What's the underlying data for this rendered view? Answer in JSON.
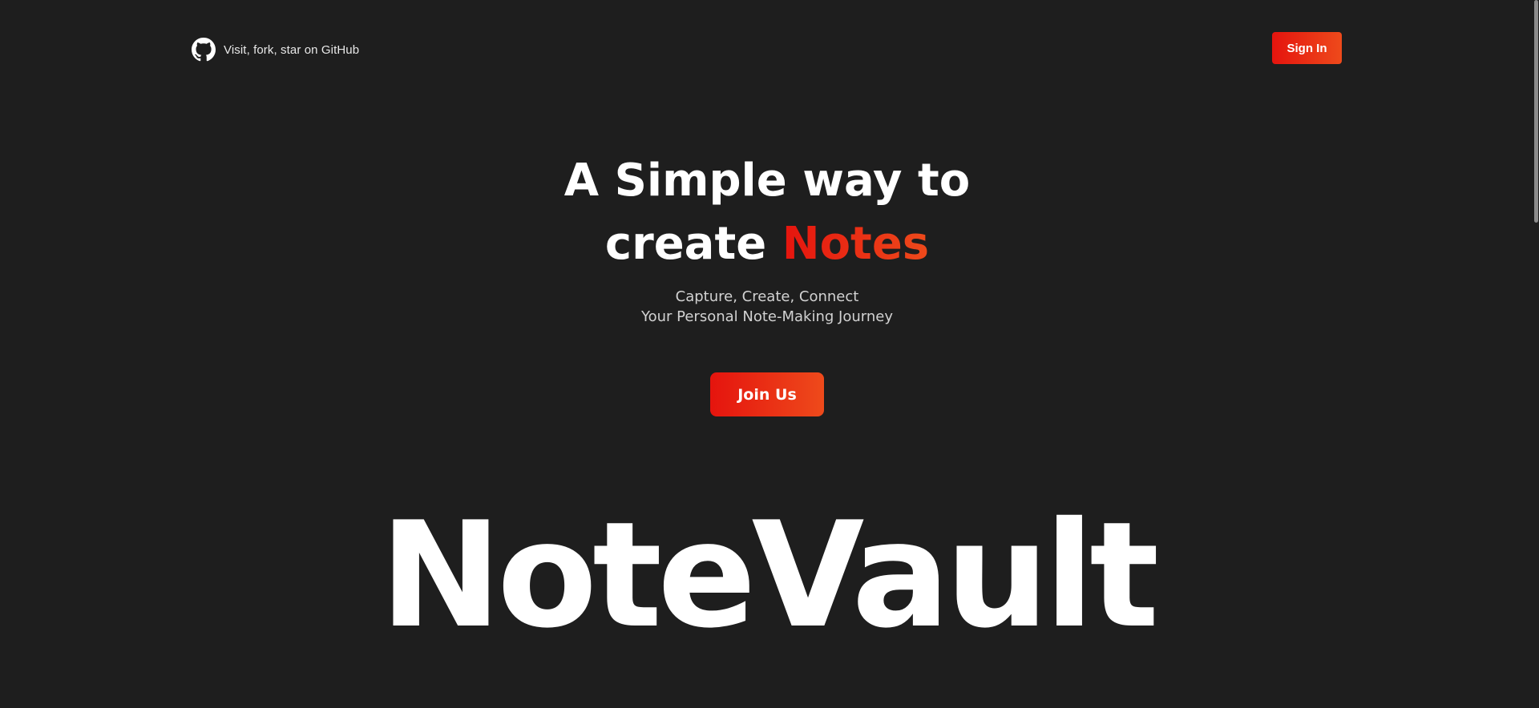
{
  "header": {
    "github_label": "Visit, fork, star on GitHub",
    "github_icon": "github-icon",
    "signin_label": "Sign In"
  },
  "hero": {
    "title_line1": "A Simple way to",
    "title_line2_prefix": "create ",
    "title_accent": "Notes",
    "subtitle_line1": "Capture, Create, Connect",
    "subtitle_line2": "Your Personal Note-Making Journey",
    "cta_label": "Join Us"
  },
  "brand": {
    "name": "NoteVault"
  },
  "colors": {
    "background": "#1e1e1e",
    "accent_start": "#e5140e",
    "accent_end": "#ee4a1b",
    "text": "#ffffff",
    "subtext": "#d2d2d2"
  }
}
